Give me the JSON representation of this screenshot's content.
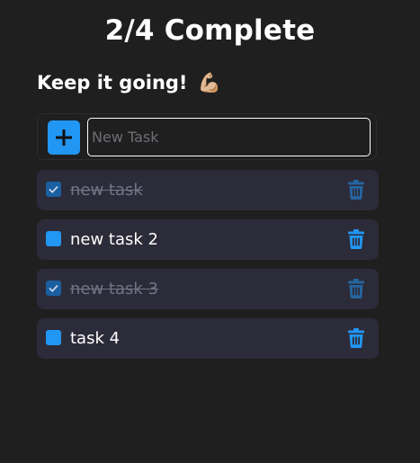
{
  "header": {
    "title": "2/4 Complete",
    "subtitle": "Keep it going!",
    "subtitle_emoji": "💪🏼"
  },
  "new_task": {
    "placeholder": "New Task",
    "value": ""
  },
  "colors": {
    "accent": "#2196f3",
    "background": "#1f1f20",
    "card": "#2c2b39",
    "done_text": "#6f7686"
  },
  "tasks": [
    {
      "label": "new task",
      "completed": true
    },
    {
      "label": "new task 2",
      "completed": false
    },
    {
      "label": "new task 3",
      "completed": true
    },
    {
      "label": "task 4",
      "completed": false
    }
  ],
  "icons": {
    "add": "plus-icon",
    "delete": "trash-icon",
    "checked": "checkmark-icon"
  }
}
